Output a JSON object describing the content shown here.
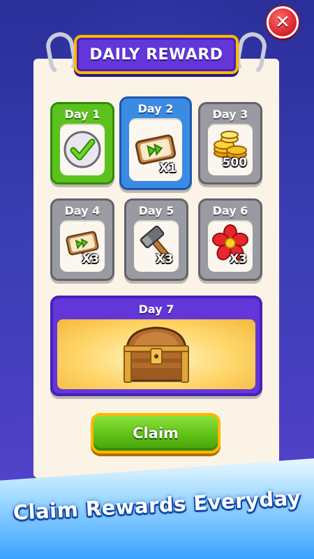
{
  "title": "DAILY REWARD",
  "close_symbol": "✕",
  "days": [
    {
      "label": "Day 1",
      "icon": "checkmark-icon",
      "quantity": "",
      "state": "claimed"
    },
    {
      "label": "Day 2",
      "icon": "skip-ticket-icon",
      "quantity": "X1",
      "state": "current"
    },
    {
      "label": "Day 3",
      "icon": "gold-coins-icon",
      "quantity": "500",
      "state": "locked"
    },
    {
      "label": "Day 4",
      "icon": "skip-ticket-icon",
      "quantity": "X3",
      "state": "locked"
    },
    {
      "label": "Day 5",
      "icon": "hammer-icon",
      "quantity": "X3",
      "state": "locked"
    },
    {
      "label": "Day 6",
      "icon": "flower-icon",
      "quantity": "X3",
      "state": "locked"
    },
    {
      "label": "Day 7",
      "icon": "treasure-chest-icon",
      "quantity": "",
      "state": "locked"
    }
  ],
  "claim_button": "Claim",
  "banner": "Claim Rewards Everyday",
  "colors": {
    "claimed": "#5bc21d",
    "current": "#3b8be3",
    "locked": "#9a9aa3",
    "title_bg": "#6236d9",
    "accent_border": "#ffb800"
  }
}
